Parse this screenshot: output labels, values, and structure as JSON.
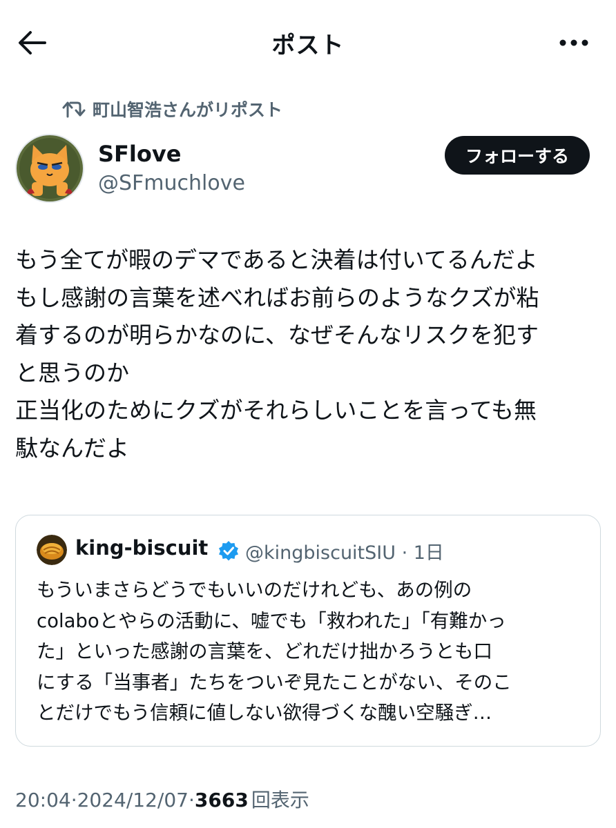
{
  "header": {
    "title": "ポスト",
    "back_icon": "arrow-left-icon",
    "more_icon": "more-horizontal-icon"
  },
  "repost": {
    "icon": "repost-icon",
    "text": "町山智浩さんがリポスト"
  },
  "author": {
    "name": "SFlove",
    "handle": "@SFmuchlove",
    "follow_label": "フォローする"
  },
  "post": {
    "lines": [
      "もう全てが暇のデマであると決着は付いてるんだよ",
      "もし感謝の言葉を述べればお前らのようなクズが粘",
      "着するのが明らかなのに、なぜそんなリスクを犯す",
      "と思うのか",
      "正当化のためにクズがそれらしいことを言っても無",
      "駄なんだよ"
    ]
  },
  "quote": {
    "name": "king-biscuit",
    "verified_icon": "verified-badge-icon",
    "meta": "@kingbiscuitSIU · 1日",
    "lines": [
      "もういまさらどうでもいいのだけれども、あの例の",
      "colaboとやらの活動に、嘘でも「救われた」「有難かっ",
      "た」といった感謝の言葉を、どれだけ拙かろうとも口",
      "にする「当事者」たちをついぞ見たことがない、そのこ",
      "とだけでもう信頼に値しない欲得づくな醜い空騒ぎ…"
    ]
  },
  "meta": {
    "time": "20:04",
    "sep1": " · ",
    "date": "2024/12/07",
    "sep2": " · ",
    "views": "3663",
    "views_label": "回表示"
  },
  "colors": {
    "text": "#0f1419",
    "secondary": "#536471",
    "border": "#cfd9de",
    "verified": "#1d9bf0",
    "follow_bg": "#0f1419"
  }
}
